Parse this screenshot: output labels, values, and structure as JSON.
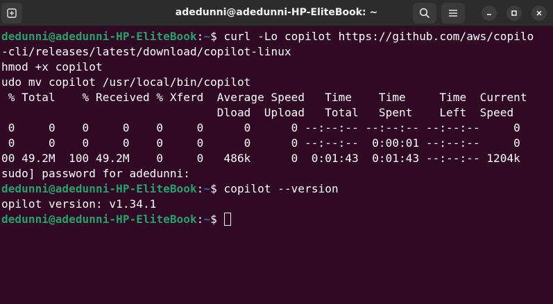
{
  "window": {
    "title": "adedunni@adedunni-HP-EliteBook: ~"
  },
  "icons": {
    "new_tab": "new-tab-icon",
    "search": "search-icon",
    "menu": "hamburger-menu-icon",
    "minimize": "minimize-icon",
    "maximize": "maximize-icon",
    "close": "close-icon"
  },
  "colors": {
    "background": "#300a24",
    "prompt_user": "#26a269",
    "prompt_path": "#3465a4",
    "text": "#ffffff"
  },
  "terminal": {
    "prompt_user": "dedunni@adedunni-HP-EliteBook",
    "prompt_colon": ":",
    "prompt_path": "~",
    "prompt_symbol": "$ ",
    "cmd1": "curl -Lo copilot https://github.com/aws/copilo",
    "lines": [
      "-cli/releases/latest/download/copilot-linux",
      "hmod +x copilot",
      "udo mv copilot /usr/local/bin/copilot",
      " % Total    % Received % Xferd  Average Speed   Time    Time     Time  Current",
      "                                Dload  Upload   Total   Spent    Left  Speed",
      " 0     0    0     0    0     0      0      0 --:--:-- --:--:-- --:--:--     0",
      " 0     0    0     0    0     0      0      0 --:--:--  0:00:01 --:--:--     0",
      "00 49.2M  100 49.2M    0     0   486k      0  0:01:43  0:01:43 --:--:-- 1204k",
      "sudo] password for adedunni:"
    ],
    "cmd2": "copilot --version",
    "output2": "opilot version: v1.34.1"
  }
}
